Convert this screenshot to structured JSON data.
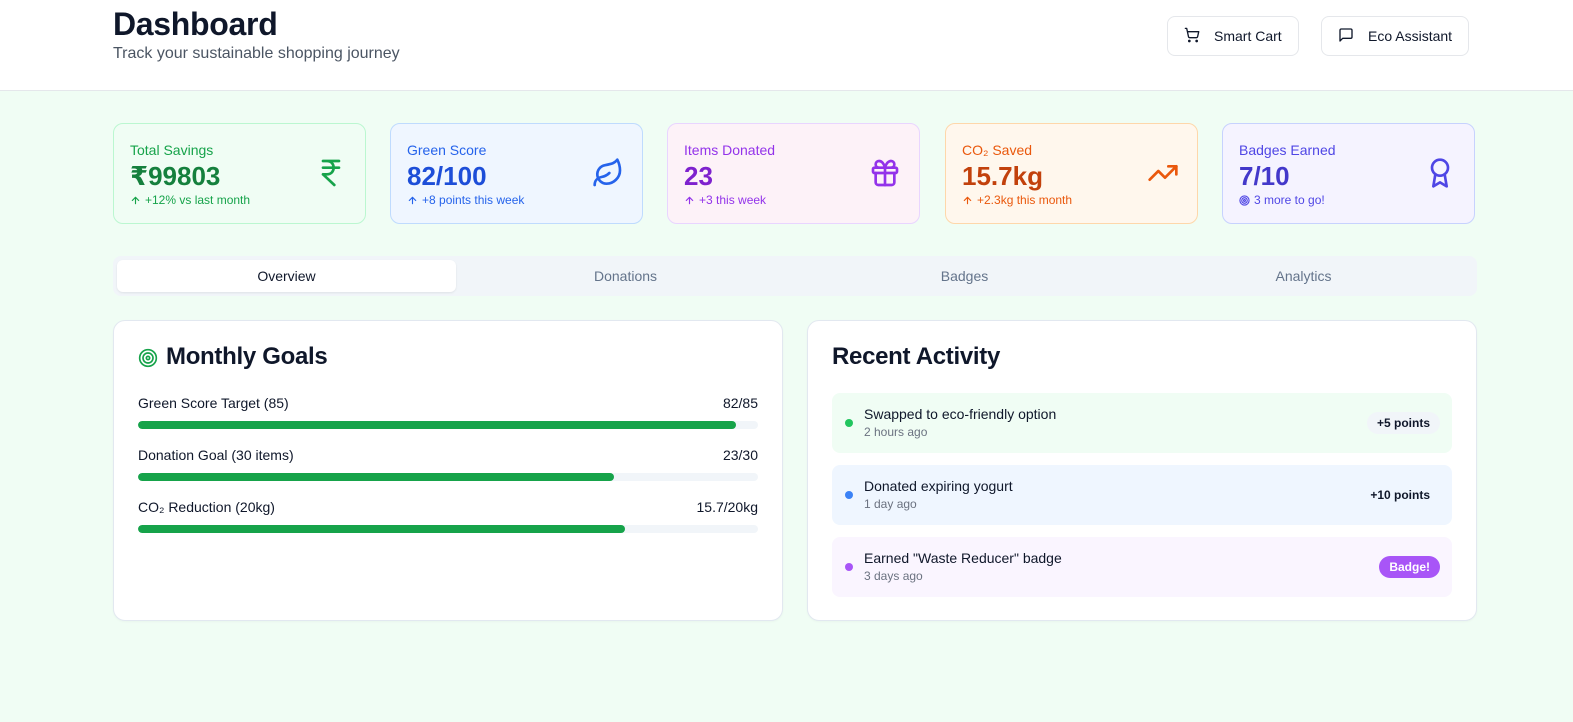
{
  "header": {
    "title": "Dashboard",
    "subtitle": "Track your sustainable shopping journey",
    "buttons": [
      {
        "label": "Smart Cart",
        "icon": "shopping-cart-icon"
      },
      {
        "label": "Eco Assistant",
        "icon": "message-square-icon"
      }
    ]
  },
  "stats": [
    {
      "label": "Total Savings",
      "value": "₹99803",
      "sub": "+12% vs last month",
      "icon": "rupee-icon",
      "color": "#16a34a"
    },
    {
      "label": "Green Score",
      "value": "82/100",
      "sub": "+8 points this week",
      "icon": "leaf-icon",
      "color": "#2563eb"
    },
    {
      "label": "Items Donated",
      "value": "23",
      "sub": "+3 this week",
      "icon": "gift-icon",
      "color": "#9333ea"
    },
    {
      "label": "CO₂ Saved",
      "value": "15.7kg",
      "sub": "+2.3kg this month",
      "icon": "trending-up-icon",
      "color": "#ea580c"
    },
    {
      "label": "Badges Earned",
      "value": "7/10",
      "sub": "3 more to go!",
      "icon": "award-icon",
      "color": "#4f46e5"
    }
  ],
  "tabs": [
    {
      "label": "Overview",
      "active": true
    },
    {
      "label": "Donations",
      "active": false
    },
    {
      "label": "Badges",
      "active": false
    },
    {
      "label": "Analytics",
      "active": false
    }
  ],
  "goals": {
    "title": "Monthly Goals",
    "icon": "target-icon",
    "items": [
      {
        "label": "Green Score Target (85)",
        "value": "82/85",
        "progress": 0.965
      },
      {
        "label": "Donation Goal (30 items)",
        "value": "23/30",
        "progress": 0.767
      },
      {
        "label": "CO₂ Reduction (20kg)",
        "value": "15.7/20kg",
        "progress": 0.785
      }
    ]
  },
  "activity": {
    "title": "Recent Activity",
    "items": [
      {
        "title": "Swapped to eco-friendly option",
        "time": "2 hours ago",
        "badge": "+5 points",
        "dot_color": "#22c55e"
      },
      {
        "title": "Donated expiring yogurt",
        "time": "1 day ago",
        "badge": "+10 points",
        "dot_color": "#3b82f6"
      },
      {
        "title": "Earned \"Waste Reducer\" badge",
        "time": "3 days ago",
        "badge": "Badge!",
        "dot_color": "#a855f7"
      }
    ]
  }
}
